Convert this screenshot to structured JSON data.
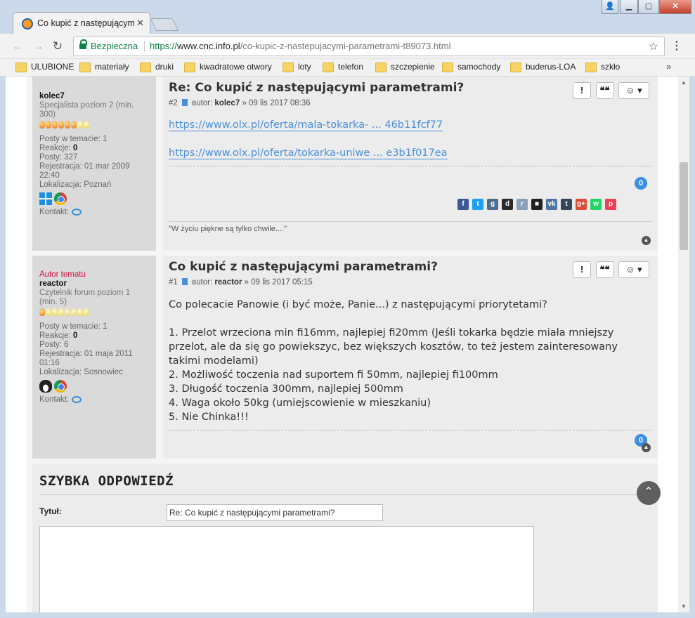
{
  "browser": {
    "tab_title": "Co kupić z następującymi",
    "secure_label": "Bezpieczna",
    "url_proto": "https://",
    "url_host": "www.cnc.info.pl",
    "url_path": "/co-kupic-z-nastepujacymi-parametrami-t89073.html",
    "bookmarks": [
      "ULUBIONE",
      "materiały",
      "druki",
      "kwadratowe otwory",
      "loty",
      "telefon",
      "szczepienie",
      "samochody",
      "buderus-LOA",
      "szkło"
    ],
    "bookmarks_more": "»"
  },
  "posts": [
    {
      "title": "Re: Co kupić z następującymi parametrami?",
      "number": "#2",
      "author_label": "autor:",
      "author": "kolec7",
      "date": "» 09 lis 2017 08:36",
      "profile": {
        "author_tag": "",
        "username": "kolec7",
        "rank": "Specjalista poziom 2 (min. 300)",
        "bulbs_on": 6,
        "bulbs_total": 8,
        "stats": [
          {
            "label": "Posty w temacie:",
            "value": "1"
          },
          {
            "label": "Reakcje:",
            "value": "0",
            "bold": true
          },
          {
            "label": "Posty:",
            "value": "327"
          },
          {
            "label": "Rejestracja:",
            "value": "01 mar 2009 22:40"
          },
          {
            "label": "Lokalizacja:",
            "value": "Poznań"
          }
        ],
        "contact_label": "Kontakt:"
      },
      "links": [
        "https://www.olx.pl/oferta/mala-tokarka- ... 46b11fcf77",
        "https://www.olx.pl/oferta/tokarka-uniwe ... e3b1f017ea"
      ],
      "reactions": "0",
      "signature": "\"W życiu piękne są tylko chwile....\""
    },
    {
      "title": "Co kupić z następującymi parametrami?",
      "number": "#1",
      "author_label": "autor:",
      "author": "reactor",
      "date": "» 09 lis 2017 05:15",
      "profile": {
        "author_tag": "Autor tematu",
        "username": "reactor",
        "rank": "Czytelnik forum poziom 1 (min. 5)",
        "bulbs_on": 1,
        "bulbs_total": 8,
        "stats": [
          {
            "label": "Posty w temacie:",
            "value": "1"
          },
          {
            "label": "Reakcje:",
            "value": "0",
            "bold": true
          },
          {
            "label": "Posty:",
            "value": "6"
          },
          {
            "label": "Rejestracja:",
            "value": "01 maja 2011 01:16"
          },
          {
            "label": "Lokalizacja:",
            "value": "Sosnowiec"
          }
        ],
        "contact_label": "Kontakt:"
      },
      "body": [
        "Co polecacie Panowie (i być może, Panie...) z następującymi priorytetami?",
        "",
        "1. Przelot wrzeciona min fi16mm, najlepiej fi20mm (Jeśli tokarka będzie miała mniejszy przelot, ale da się go powiekszyc, bez większych kosztów, to też jestem zainteresowany takimi modelami)",
        "2. Możliwość toczenia nad suportem fi 50mm, najlepiej fi100mm",
        "3. Długość toczenia 300mm, najlepiej 500mm",
        "4. Waga około 50kg (umiejscowienie w mieszkaniu)",
        "5. Nie Chinka!!!"
      ],
      "reactions": "0"
    }
  ],
  "actions": {
    "report": "!",
    "quote": "❝❝",
    "react": "☺ ▾"
  },
  "quick_reply": {
    "heading": "SZYBKA ODPOWIEDŹ",
    "title_label": "Tytuł:",
    "title_value": "Re: Co kupić z następującymi parametrami?"
  },
  "share_icons": [
    "f",
    "t",
    "g",
    "d",
    "r",
    "■",
    "vk",
    "t",
    "g+",
    "w",
    "p"
  ],
  "colors": {
    "link": "#4a90d9",
    "badge": "#3b8fe0",
    "author_tag": "#d31141"
  }
}
